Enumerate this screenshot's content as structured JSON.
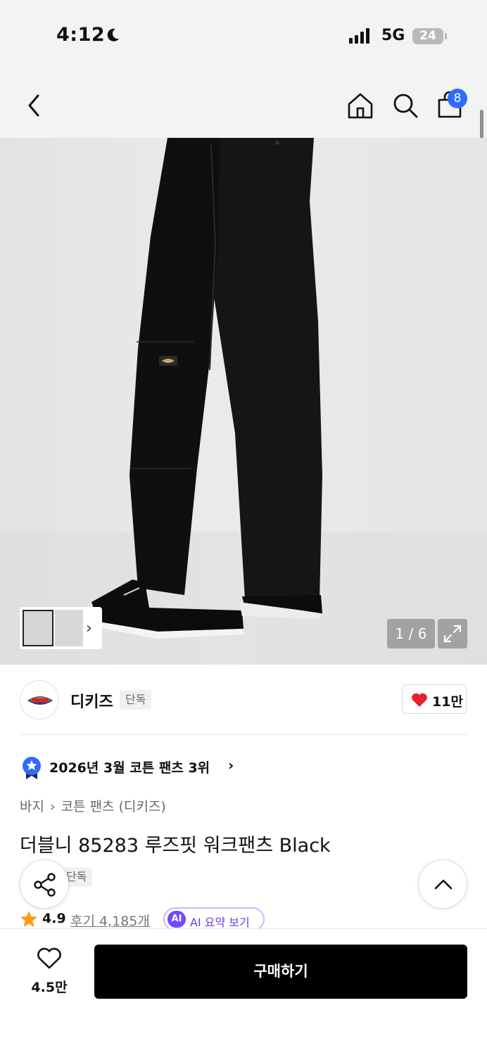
{
  "status_bar": {
    "time": "4:12",
    "network": "5G",
    "battery": "24"
  },
  "nav": {
    "cart_count": "8"
  },
  "gallery": {
    "counter": "1 / 6"
  },
  "brand": {
    "name": "디키즈",
    "tag": "단독",
    "likes": "11만"
  },
  "ranking": {
    "text": "2026년 3월 코튼 팬츠 3위"
  },
  "breadcrumb": {
    "category": "바지",
    "subcategory": "코튼 팬츠 (디키즈)"
  },
  "product": {
    "title": "더블니 85283 루즈핏 워크팬츠 Black",
    "exclusive_tag": "단독",
    "rating": "4.9",
    "reviews_label": "후기 4,185개",
    "ai_badge": "AI",
    "ai_summary_label": "AI 요약 보기"
  },
  "bottom_bar": {
    "wish_count": "4.5만",
    "buy_label": "구매하기"
  },
  "colors": {
    "accent_blue": "#2f6bff",
    "heart_red": "#e8202a",
    "star_orange": "#ff9a1a",
    "ai_purple": "#6f4bff",
    "buy_black": "#000000"
  }
}
